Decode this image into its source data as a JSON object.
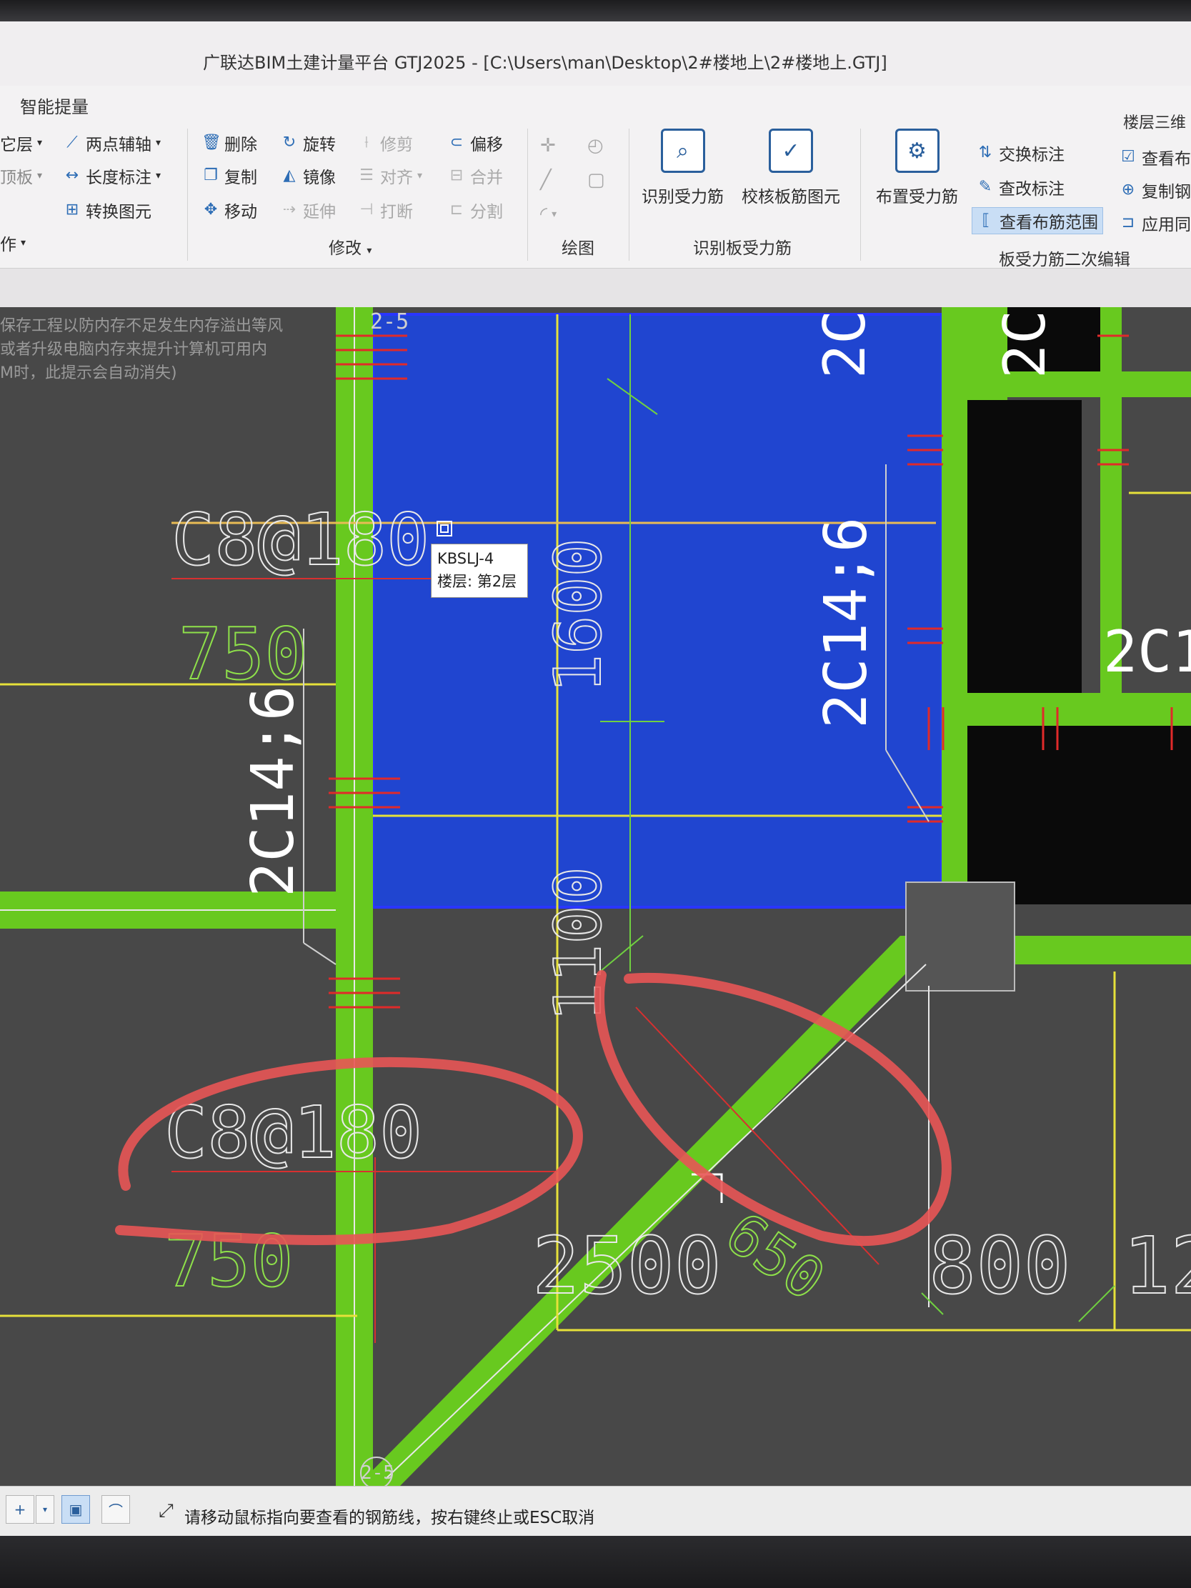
{
  "window": {
    "title": "广联达BIM土建计量平台 GTJ2025 - [C:\\Users\\man\\Desktop\\2#楼地上\\2#楼地上.GTJ]"
  },
  "ribbon": {
    "tab_smart": "智能提量",
    "top_right_fragment": "楼层三维",
    "left_partial": {
      "item1": "它层",
      "item2": "顶板",
      "item3": "作"
    },
    "axis_group": {
      "two_point_axis": "两点辅轴",
      "length_mark": "长度标注",
      "convert_element": "转换图元"
    },
    "modify_group": {
      "delete": "删除",
      "rotate": "旋转",
      "trim": "修剪",
      "offset": "偏移",
      "copy": "复制",
      "mirror": "镜像",
      "align": "对齐",
      "merge": "合并",
      "move": "移动",
      "extend": "延伸",
      "break": "打断",
      "split": "分割",
      "label": "修改"
    },
    "draw_group": {
      "label": "绘图"
    },
    "identify_group": {
      "identify_rebar": "识别受力筋",
      "check_rebar": "校核板筋图元",
      "label": "识别板受力筋"
    },
    "edit_group": {
      "place_rebar": "布置受力筋",
      "swap_mark": "交换标注",
      "change_mark": "查改标注",
      "view_range": "查看布筋范围",
      "view_partial": "查看布",
      "copy_partial": "复制钢",
      "apply_partial": "应用同",
      "label": "板受力筋二次编辑"
    }
  },
  "canvas": {
    "hint_lines": [
      "保存工程以防内存不足发生内存溢出等风",
      "或者升级电脑内存来提升计算机可用内",
      "M时，此提示会自动消失)"
    ],
    "tooltip": {
      "name": "KBSLJ-4",
      "floor": "楼层: 第2层"
    },
    "annotations": {
      "rebar_top": "C8@180",
      "len_top": "750",
      "rebar_bottom": "C8@180",
      "len_bottom": "750",
      "edge_left": "2C14;6",
      "edge_mid": "2C14;6",
      "dim_1600": "1600",
      "dim_1100": "1100",
      "dim_2500": "2500",
      "dim_800": "800",
      "dim_12": "12",
      "diag_650": "650",
      "axis_top": "2-5",
      "axis_bottom": "2-5",
      "right_top": "2C",
      "right_mid": "2C1",
      "blue_top": "2C"
    }
  },
  "status_bar": {
    "message": "请移动鼠标指向要查看的钢筋线，按右键终止或ESC取消"
  }
}
